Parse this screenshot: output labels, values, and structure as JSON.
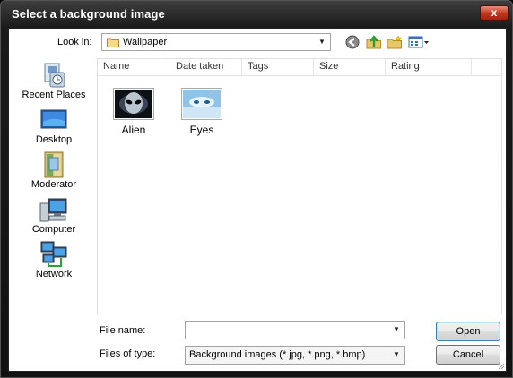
{
  "window": {
    "title": "Select a background image",
    "close_glyph": "x"
  },
  "toolbar": {
    "lookin_label": "Look in:",
    "lookin_value": "Wallpaper",
    "icons": [
      "back-icon",
      "up-folder-icon",
      "new-folder-icon",
      "views-menu-icon"
    ]
  },
  "places": [
    {
      "label": "Recent Places",
      "icon": "recent-places-icon"
    },
    {
      "label": "Desktop",
      "icon": "desktop-icon"
    },
    {
      "label": "Moderator",
      "icon": "user-folder-icon"
    },
    {
      "label": "Computer",
      "icon": "computer-icon"
    },
    {
      "label": "Network",
      "icon": "network-icon"
    }
  ],
  "filelist": {
    "columns": [
      "Name",
      "Date taken",
      "Tags",
      "Size",
      "Rating"
    ],
    "items": [
      {
        "name": "Alien",
        "icon": "alien-thumbnail"
      },
      {
        "name": "Eyes",
        "icon": "eyes-thumbnail"
      }
    ]
  },
  "footer": {
    "filename_label": "File name:",
    "filename_value": "",
    "filetype_label": "Files of type:",
    "filetype_value": "Background images (*.jpg, *.png, *.bmp)",
    "open_label": "Open",
    "cancel_label": "Cancel"
  },
  "colors": {
    "title_bar": "#1a1a1a",
    "close_button": "#c0341d",
    "default_button_border": "#3c7fb1"
  }
}
